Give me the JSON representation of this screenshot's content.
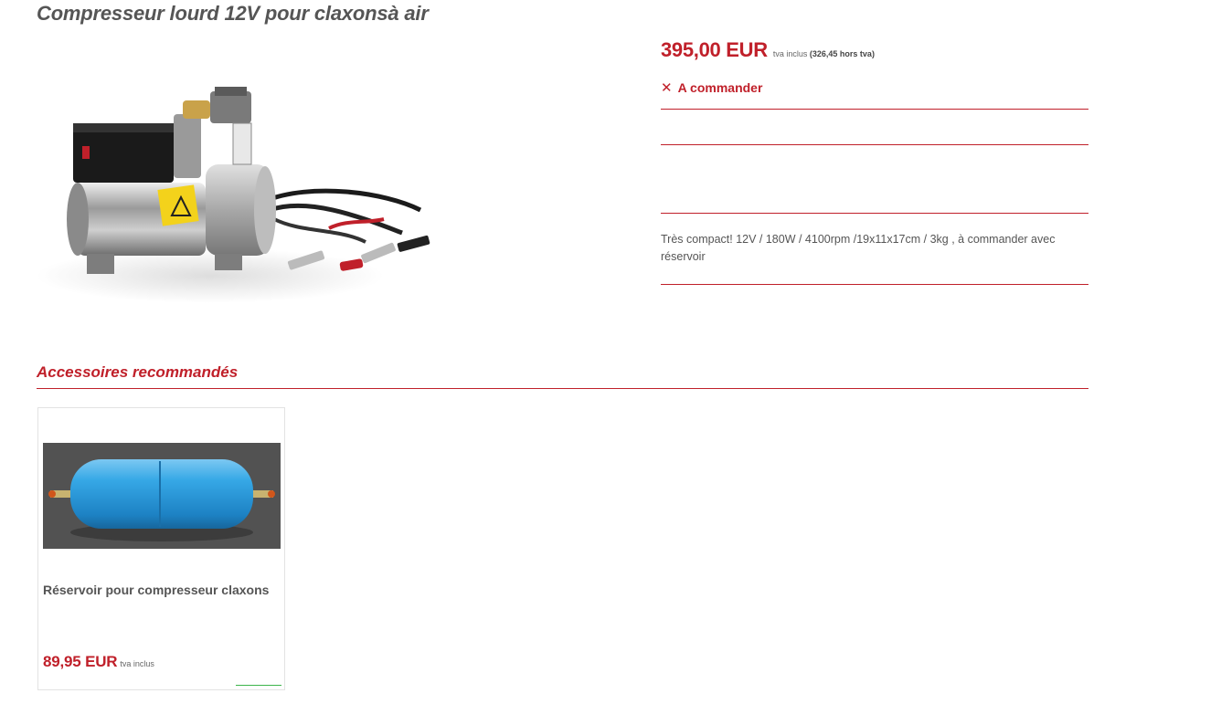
{
  "product": {
    "title": "Compresseur lourd 12V pour claxonsà air",
    "image_icon": "compressor-photo",
    "price": "395,00 EUR",
    "tax_label": "tva inclus",
    "price_excl": "(326,45 hors tva)",
    "availability": "A commander",
    "availability_icon": "x-icon",
    "description": "Très compact! 12V / 180W / 4100rpm /19x11x17cm / 3kg , à commander avec réservoir"
  },
  "accessories": {
    "heading": "Accessoires recommandés",
    "items": [
      {
        "name": "Réservoir pour compresseur claxons",
        "image_icon": "air-tank-photo",
        "price": "89,95 EUR",
        "tax_label": "tva inclus"
      }
    ]
  },
  "colors": {
    "accent": "#c0202a",
    "text": "#555555",
    "tank_blue": "#2e9fe0",
    "green_line": "#3cb44b"
  }
}
